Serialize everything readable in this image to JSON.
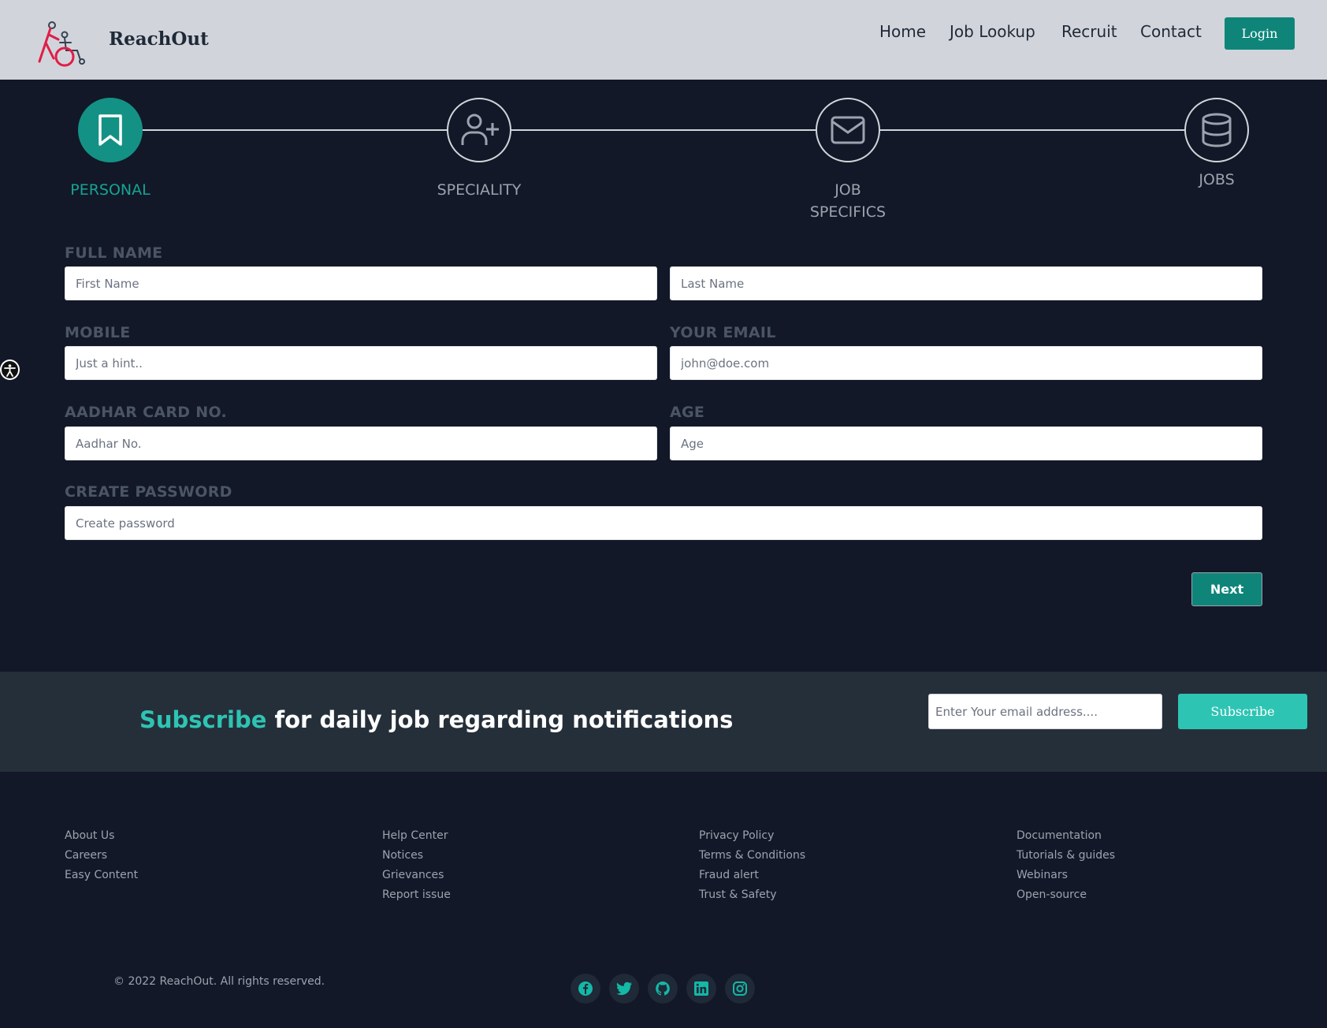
{
  "header": {
    "brand": "ReachOut",
    "nav": [
      "Home",
      "Job Lookup",
      "Recruit",
      "Contact"
    ],
    "login_label": "Login"
  },
  "stepper": {
    "steps": [
      {
        "label": "PERSONAL",
        "icon": "bookmark-icon",
        "active": true
      },
      {
        "label": "SPECIALITY",
        "icon": "user-plus-icon",
        "active": false
      },
      {
        "label": "JOB SPECIFICS",
        "icon": "mail-icon",
        "active": false
      },
      {
        "label": "JOBS",
        "icon": "database-icon",
        "active": false
      }
    ]
  },
  "form": {
    "full_name_label": "FULL NAME",
    "first_name_placeholder": "First Name",
    "last_name_placeholder": "Last Name",
    "mobile_label": "MOBILE",
    "mobile_placeholder": "Just a hint..",
    "email_label": "YOUR EMAIL",
    "email_placeholder": "john@doe.com",
    "aadhar_label": "AADHAR CARD NO.",
    "aadhar_placeholder": "Aadhar No.",
    "age_label": "AGE",
    "age_placeholder": "Age",
    "password_label": "CREATE PASSWORD",
    "password_placeholder": "Create password",
    "next_label": "Next"
  },
  "subscribe": {
    "accent": "Subscribe",
    "rest": " for daily job regarding notifications",
    "email_placeholder": "Enter Your email address....",
    "button_label": "Subscribe"
  },
  "footer": {
    "columns": [
      [
        "About Us",
        "Careers",
        "Easy Content"
      ],
      [
        "Help Center",
        "Notices",
        "Grievances",
        "Report issue"
      ],
      [
        "Privacy Policy",
        "Terms & Conditions",
        "Fraud alert",
        "Trust & Safety"
      ],
      [
        "Documentation",
        "Tutorials & guides",
        "Webinars",
        "Open-source"
      ]
    ],
    "copyright": "© 2022 ReachOut. All rights reserved.",
    "social": [
      "facebook-icon",
      "twitter-icon",
      "github-icon",
      "linkedin-icon",
      "instagram-icon"
    ]
  },
  "colors": {
    "background": "#121827",
    "header": "#d1d5db",
    "accent": "#0f857a",
    "subscribe_accent": "#2ec4b3",
    "subscribe_band": "#252f3a"
  }
}
